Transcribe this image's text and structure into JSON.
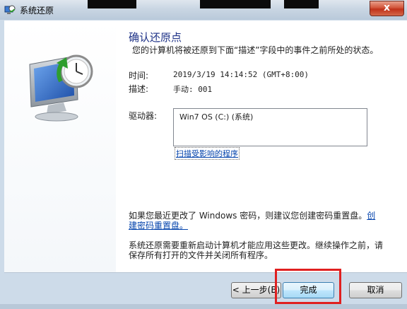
{
  "window": {
    "title": "系统还原",
    "close_glyph": "x"
  },
  "page": {
    "heading": "确认还原点",
    "subtitle": "您的计算机将被还原到下面“描述”字段中的事件之前所处的状态。",
    "time_label": "时间:",
    "time_value": "2019/3/19 14:14:52 (GMT+8:00)",
    "desc_label": "描述:",
    "desc_value": "手动: 001",
    "drives_label": "驱动器:",
    "drives": [
      "Win7 OS (C:) (系统)"
    ],
    "scan_link": "扫描受影响的程序",
    "password_note_prefix": "如果您最近更改了 Windows 密码，则建议您创建密码重置盘。",
    "password_link": "创建密码重置盘。",
    "restart_note": "系统还原需要重新启动计算机才能应用这些更改。继续操作之前，请保存所有打开的文件并关闭所有程序。"
  },
  "buttons": {
    "back": "< 上一步(B)",
    "finish": "完成",
    "cancel": "取消"
  },
  "colors": {
    "heading": "#1e3287",
    "link": "#0645ad",
    "highlight": "#e02020"
  },
  "icons": [
    "system-restore-icon",
    "computer-clock-icon",
    "close-icon"
  ]
}
